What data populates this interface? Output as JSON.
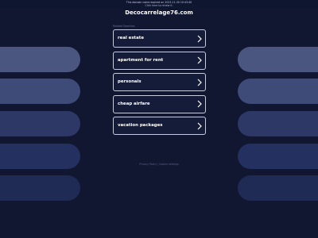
{
  "notice": {
    "line1": "This domain name expired on 2023-11-30 10:43:40",
    "line2": "Click here to renew it."
  },
  "domain": "Decocarrelage76.com",
  "related_heading": "Related Searches",
  "links": [
    {
      "label": "real estate"
    },
    {
      "label": "apartment for rent"
    },
    {
      "label": "personals"
    },
    {
      "label": "cheap airfare"
    },
    {
      "label": "vacation packages"
    }
  ],
  "footer": {
    "text": "Privacy Policy | Cookie settings"
  },
  "colors": {
    "background": "#111731",
    "pill_row1": "#4a5580",
    "pill_row2": "#3e4a77",
    "pill_row3": "#2d3866",
    "pill_row4": "#243060",
    "pill_row5": "#1f2a55",
    "link_border": "#c7ccdf"
  },
  "icons": {
    "link_chevron": "chevron-right-icon"
  }
}
